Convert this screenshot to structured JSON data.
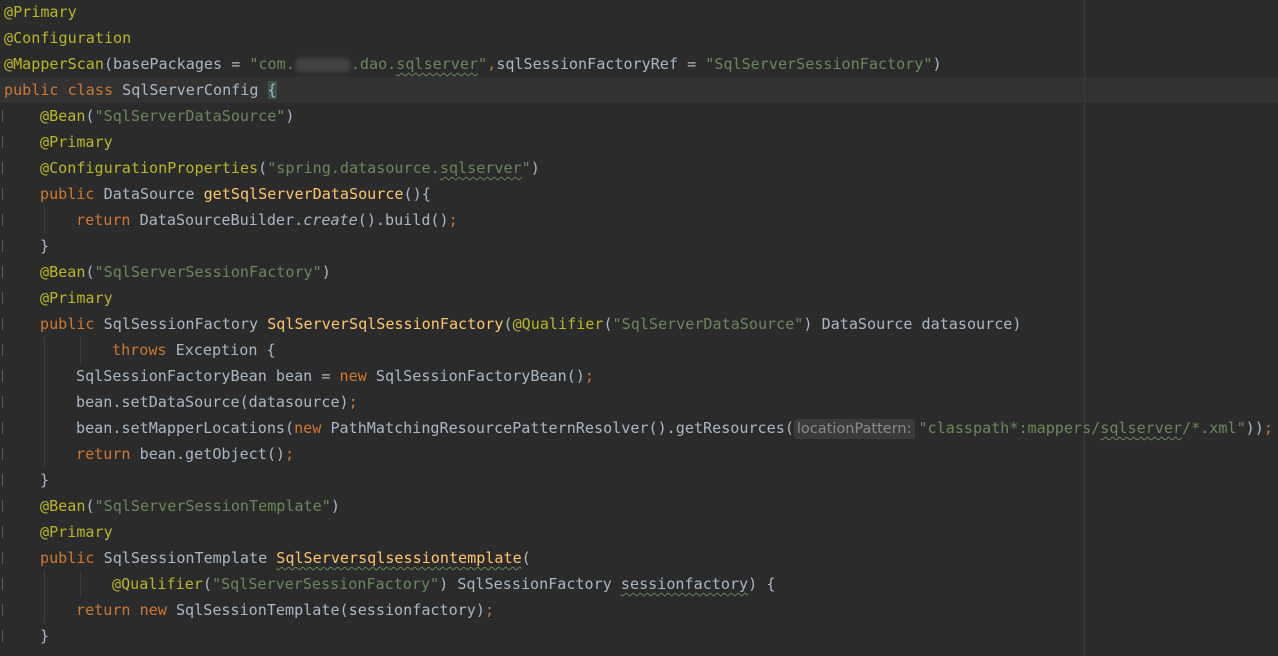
{
  "code_lines": [
    {
      "id": "line-1",
      "indent": 0,
      "tokens": [
        {
          "t": "ann",
          "v": "@Primary"
        }
      ]
    },
    {
      "id": "line-2",
      "indent": 0,
      "tokens": [
        {
          "t": "ann",
          "v": "@Configuration"
        }
      ]
    },
    {
      "id": "line-3",
      "indent": 0,
      "tokens": [
        {
          "t": "ann",
          "v": "@MapperScan"
        },
        {
          "t": "plain",
          "v": "(basePackages = "
        },
        {
          "t": "str",
          "v": "\"com."
        },
        {
          "t": "redact",
          "v": ""
        },
        {
          "t": "str",
          "v": ".dao."
        },
        {
          "t": "str_sq",
          "v": "sqlserver"
        },
        {
          "t": "str",
          "v": "\""
        },
        {
          "t": "semi",
          "v": ","
        },
        {
          "t": "plain",
          "v": "sqlSessionFactoryRef = "
        },
        {
          "t": "str",
          "v": "\"SqlServerSessionFactory\""
        },
        {
          "t": "plain",
          "v": ")"
        }
      ]
    },
    {
      "id": "line-4",
      "indent": 0,
      "current": true,
      "tokens": [
        {
          "t": "kw",
          "v": "public class "
        },
        {
          "t": "plain",
          "v": "SqlServerConfig "
        },
        {
          "t": "brace",
          "v": "{"
        }
      ]
    },
    {
      "id": "line-5",
      "indent": 1,
      "tokens": [
        {
          "t": "ann",
          "v": "@Bean"
        },
        {
          "t": "plain",
          "v": "("
        },
        {
          "t": "str",
          "v": "\"SqlServerDataSource\""
        },
        {
          "t": "plain",
          "v": ")"
        }
      ]
    },
    {
      "id": "line-6",
      "indent": 1,
      "tokens": [
        {
          "t": "ann",
          "v": "@Primary"
        }
      ]
    },
    {
      "id": "line-7",
      "indent": 1,
      "tokens": [
        {
          "t": "ann",
          "v": "@ConfigurationProperties"
        },
        {
          "t": "plain",
          "v": "("
        },
        {
          "t": "str",
          "v": "\"spring.datasource."
        },
        {
          "t": "str_sq",
          "v": "sqlserver"
        },
        {
          "t": "str",
          "v": "\""
        },
        {
          "t": "plain",
          "v": ")"
        }
      ]
    },
    {
      "id": "line-8",
      "indent": 1,
      "tokens": [
        {
          "t": "kw",
          "v": "public "
        },
        {
          "t": "plain",
          "v": "DataSource "
        },
        {
          "t": "fn",
          "v": "getSqlServerDataSource"
        },
        {
          "t": "plain",
          "v": "(){"
        }
      ]
    },
    {
      "id": "line-9",
      "indent": 2,
      "tokens": [
        {
          "t": "kw",
          "v": "return "
        },
        {
          "t": "plain",
          "v": "DataSourceBuilder."
        },
        {
          "t": "italic",
          "v": "create"
        },
        {
          "t": "plain",
          "v": "().build()"
        },
        {
          "t": "semi",
          "v": ";"
        }
      ]
    },
    {
      "id": "line-10",
      "indent": 1,
      "tokens": [
        {
          "t": "plain",
          "v": "}"
        }
      ]
    },
    {
      "id": "line-11",
      "indent": 1,
      "tokens": [
        {
          "t": "ann",
          "v": "@Bean"
        },
        {
          "t": "plain",
          "v": "("
        },
        {
          "t": "str",
          "v": "\"SqlServerSessionFactory\""
        },
        {
          "t": "plain",
          "v": ")"
        }
      ]
    },
    {
      "id": "line-12",
      "indent": 1,
      "tokens": [
        {
          "t": "ann",
          "v": "@Primary"
        }
      ]
    },
    {
      "id": "line-13",
      "indent": 1,
      "tokens": [
        {
          "t": "kw",
          "v": "public "
        },
        {
          "t": "plain",
          "v": "SqlSessionFactory "
        },
        {
          "t": "fn",
          "v": "SqlServerSqlSessionFactory"
        },
        {
          "t": "plain",
          "v": "("
        },
        {
          "t": "ann",
          "v": "@Qualifier"
        },
        {
          "t": "plain",
          "v": "("
        },
        {
          "t": "str",
          "v": "\"SqlServerDataSource\""
        },
        {
          "t": "plain",
          "v": ") DataSource datasource)"
        }
      ]
    },
    {
      "id": "line-14",
      "indent": 3,
      "tokens": [
        {
          "t": "kw",
          "v": "throws "
        },
        {
          "t": "plain",
          "v": "Exception {"
        }
      ]
    },
    {
      "id": "line-15",
      "indent": 2,
      "tokens": [
        {
          "t": "plain",
          "v": "SqlSessionFactoryBean bean = "
        },
        {
          "t": "kw",
          "v": "new "
        },
        {
          "t": "plain",
          "v": "SqlSessionFactoryBean()"
        },
        {
          "t": "semi",
          "v": ";"
        }
      ]
    },
    {
      "id": "line-16",
      "indent": 2,
      "tokens": [
        {
          "t": "plain",
          "v": "bean.setDataSource(datasource)"
        },
        {
          "t": "semi",
          "v": ";"
        }
      ]
    },
    {
      "id": "line-17",
      "indent": 2,
      "tokens": [
        {
          "t": "plain",
          "v": "bean.setMapperLocations("
        },
        {
          "t": "kw",
          "v": "new "
        },
        {
          "t": "plain",
          "v": "PathMatchingResourcePatternResolver().getResources("
        },
        {
          "t": "hint",
          "v": "locationPattern:"
        },
        {
          "t": "str",
          "v": "\"classpath*:mappers/"
        },
        {
          "t": "str_sq",
          "v": "sqlserver"
        },
        {
          "t": "str",
          "v": "/*.xml\""
        },
        {
          "t": "plain",
          "v": "))"
        },
        {
          "t": "semi",
          "v": ";"
        }
      ]
    },
    {
      "id": "line-18",
      "indent": 2,
      "tokens": [
        {
          "t": "kw",
          "v": "return "
        },
        {
          "t": "plain",
          "v": "bean.getObject()"
        },
        {
          "t": "semi",
          "v": ";"
        }
      ]
    },
    {
      "id": "line-19",
      "indent": 1,
      "tokens": [
        {
          "t": "plain",
          "v": "}"
        }
      ]
    },
    {
      "id": "line-20",
      "indent": 1,
      "tokens": [
        {
          "t": "ann",
          "v": "@Bean"
        },
        {
          "t": "plain",
          "v": "("
        },
        {
          "t": "str",
          "v": "\"SqlServerSessionTemplate\""
        },
        {
          "t": "plain",
          "v": ")"
        }
      ]
    },
    {
      "id": "line-21",
      "indent": 1,
      "tokens": [
        {
          "t": "ann",
          "v": "@Primary"
        }
      ]
    },
    {
      "id": "line-22",
      "indent": 1,
      "tokens": [
        {
          "t": "kw",
          "v": "public "
        },
        {
          "t": "plain",
          "v": "SqlSessionTemplate "
        },
        {
          "t": "fn_sq",
          "v": "SqlServersqlsessiontemplate"
        },
        {
          "t": "plain",
          "v": "("
        }
      ]
    },
    {
      "id": "line-23",
      "indent": 3,
      "tokens": [
        {
          "t": "ann",
          "v": "@Qualifier"
        },
        {
          "t": "plain",
          "v": "("
        },
        {
          "t": "str",
          "v": "\"SqlServerSessionFactory\""
        },
        {
          "t": "plain",
          "v": ") SqlSessionFactory "
        },
        {
          "t": "plain_sq",
          "v": "sessionfactory"
        },
        {
          "t": "plain",
          "v": ") {"
        }
      ]
    },
    {
      "id": "line-24",
      "indent": 2,
      "tokens": [
        {
          "t": "kw",
          "v": "return new "
        },
        {
          "t": "plain",
          "v": "SqlSessionTemplate(sessionfactory)"
        },
        {
          "t": "semi",
          "v": ";"
        }
      ]
    },
    {
      "id": "line-25",
      "indent": 1,
      "tokens": [
        {
          "t": "plain",
          "v": "}"
        }
      ]
    }
  ],
  "colors": {
    "background": "#2b2b2b",
    "annotation": "#bbb529",
    "keyword": "#cc7832",
    "string": "#6a8759",
    "method": "#ffc66d",
    "plain": "#a9b7c6"
  }
}
